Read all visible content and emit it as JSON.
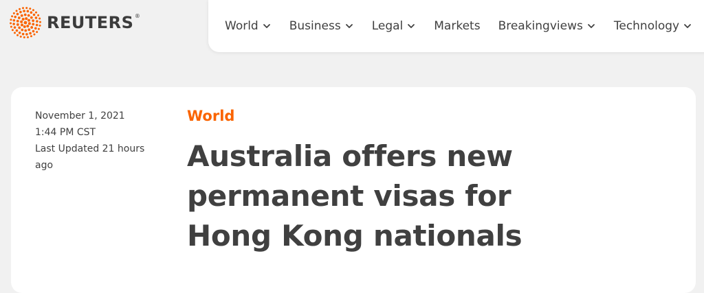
{
  "brand": {
    "name": "REUTERS",
    "registered": "®",
    "accent": "#fa6400"
  },
  "nav": {
    "items": [
      {
        "label": "World",
        "dropdown": true
      },
      {
        "label": "Business",
        "dropdown": true
      },
      {
        "label": "Legal",
        "dropdown": true
      },
      {
        "label": "Markets",
        "dropdown": false
      },
      {
        "label": "Breakingviews",
        "dropdown": true
      },
      {
        "label": "Technology",
        "dropdown": true
      }
    ]
  },
  "article": {
    "date": "November 1, 2021",
    "time": "1:44 PM CST",
    "updated_line1": "Last Updated 21 hours",
    "updated_line2": "ago",
    "section": "World",
    "headline": "Australia offers new permanent visas for Hong Kong nationals"
  }
}
